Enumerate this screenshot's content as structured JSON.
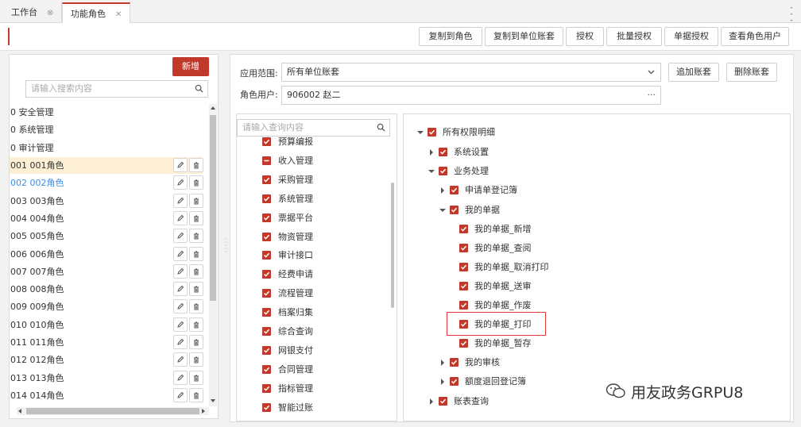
{
  "tabs": [
    {
      "label": "工作台"
    },
    {
      "label": "功能角色"
    }
  ],
  "toolbar": {
    "buttons": [
      "复制到角色",
      "复制到单位账套",
      "授权",
      "批量授权",
      "单据授权",
      "查看角色用户"
    ]
  },
  "left": {
    "add_label": "新增",
    "search_placeholder": "请输入搜索内容",
    "roles": [
      {
        "label": "0 安全管理"
      },
      {
        "label": "0 系统管理"
      },
      {
        "label": "0 审计管理"
      },
      {
        "label": "001 001角色"
      },
      {
        "label": "002 002角色"
      },
      {
        "label": "003 003角色"
      },
      {
        "label": "004 004角色"
      },
      {
        "label": "005 005角色"
      },
      {
        "label": "006 006角色"
      },
      {
        "label": "007 007角色"
      },
      {
        "label": "008 008角色"
      },
      {
        "label": "009 009角色"
      },
      {
        "label": "010 010角色"
      },
      {
        "label": "011 011角色"
      },
      {
        "label": "012 012角色"
      },
      {
        "label": "013 013角色"
      },
      {
        "label": "014 014角色"
      }
    ]
  },
  "form": {
    "scope_label": "应用范围:",
    "scope_value": "所有单位账套",
    "user_label": "角色用户:",
    "user_value": "906002 赵二",
    "add_account": "追加账套",
    "delete_account": "删除账套"
  },
  "modules": {
    "search_placeholder": "请输入查询内容",
    "items": [
      {
        "label": "预算编报"
      },
      {
        "label": "收入管理"
      },
      {
        "label": "采购管理"
      },
      {
        "label": "系统管理"
      },
      {
        "label": "票据平台"
      },
      {
        "label": "物资管理"
      },
      {
        "label": "审计接口"
      },
      {
        "label": "经费申请"
      },
      {
        "label": "流程管理"
      },
      {
        "label": "档案归集"
      },
      {
        "label": "综合查询"
      },
      {
        "label": "网银支付"
      },
      {
        "label": "合同管理"
      },
      {
        "label": "指标管理"
      },
      {
        "label": "智能过账"
      },
      {
        "label": "…"
      }
    ]
  },
  "tree": {
    "nodes": [
      {
        "label": "所有权限明细"
      },
      {
        "label": "系统设置"
      },
      {
        "label": "业务处理"
      },
      {
        "label": "申请单登记簿"
      },
      {
        "label": "我的单据"
      },
      {
        "label": "我的单据_新增"
      },
      {
        "label": "我的单据_查阅"
      },
      {
        "label": "我的单据_取消打印"
      },
      {
        "label": "我的单据_送审"
      },
      {
        "label": "我的单据_作废"
      },
      {
        "label": "我的单据_打印"
      },
      {
        "label": "我的单据_暂存"
      },
      {
        "label": "我的审核"
      },
      {
        "label": "额度退回登记簿"
      },
      {
        "label": "账表查询"
      }
    ]
  },
  "watermark": "用友政务GRPU8",
  "colors": {
    "accent": "#c0392b",
    "link": "#3a8ee6",
    "highlight": "#e53935"
  }
}
